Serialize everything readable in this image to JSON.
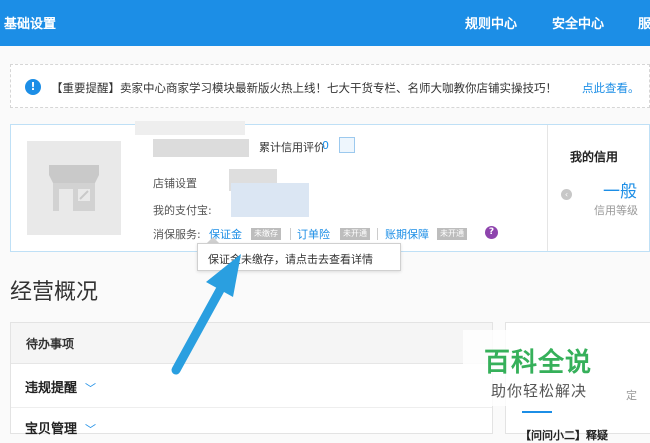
{
  "topbar": {
    "title": "基础设置",
    "nav": [
      "规则中心",
      "安全中心",
      "服"
    ]
  },
  "notice": {
    "icon": "info-icon",
    "text": "【重要提醒】卖家中心商家学习模块最新版火热上线！七大干货专栏、名师大咖教你店铺实操技巧！",
    "link": "点此查看。"
  },
  "shop": {
    "credit_label": "累计信用评价",
    "credit_value": "0",
    "settings_label": "店铺设置",
    "alipay_label": "我的支付宝:",
    "service_label": "消保服务:",
    "services": [
      {
        "name": "保证金",
        "status": "未缴存"
      },
      {
        "name": "订单险",
        "status": "未开通"
      },
      {
        "name": "账期保障",
        "status": "未开通"
      }
    ]
  },
  "credit": {
    "title": "我的信用",
    "level": "一般",
    "sub": "信用等级"
  },
  "tooltip": {
    "text": "保证金未缴存，请点击去查看详情"
  },
  "overview": {
    "title": "经营概况",
    "todo_header": "待办事项",
    "rows": [
      "违规提醒",
      "宝贝管理"
    ]
  },
  "right_panel": {
    "frag1": "定",
    "frag2": "【问问小二】释疑"
  },
  "watermark": {
    "main": "百科全说",
    "sub": "助你轻松解决"
  },
  "colors": {
    "brand_blue": "#1c8ee6",
    "arrow_blue": "#2a9fe0",
    "watermark_green": "#36b05a"
  }
}
